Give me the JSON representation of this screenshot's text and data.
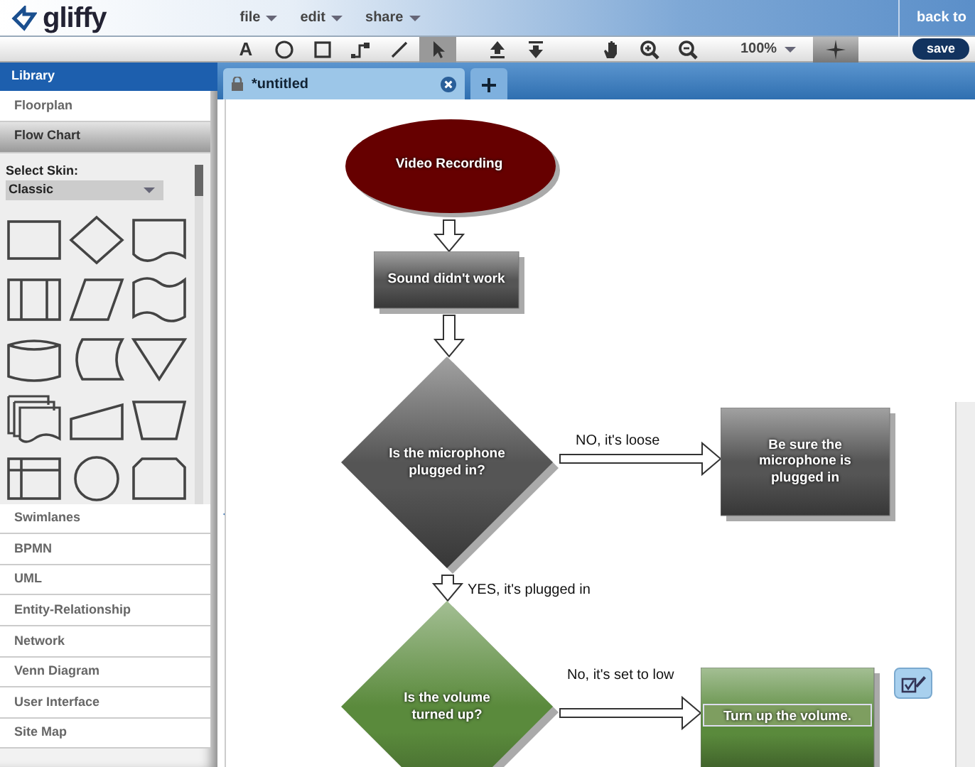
{
  "app": {
    "logo": "gliffy",
    "menus": [
      {
        "label": "file"
      },
      {
        "label": "edit"
      },
      {
        "label": "share"
      }
    ],
    "back_link": "back to"
  },
  "toolbar": {
    "tools": [
      {
        "kind": "text",
        "label": "A",
        "selected": false
      },
      {
        "kind": "ellipse",
        "selected": false
      },
      {
        "kind": "rectangle",
        "selected": false
      },
      {
        "kind": "connector",
        "selected": false
      },
      {
        "kind": "line",
        "selected": false
      },
      {
        "kind": "pointer",
        "selected": true
      }
    ],
    "actions": [
      {
        "kind": "bring-front"
      },
      {
        "kind": "send-back"
      },
      {
        "kind": "hand"
      },
      {
        "kind": "zoom-in"
      },
      {
        "kind": "zoom-out"
      }
    ],
    "zoom": "100%",
    "snap": {
      "on": true
    },
    "save": "save"
  },
  "tabs": [
    {
      "label": "*untitled",
      "selected": true
    }
  ],
  "sidebar": {
    "title": "Library",
    "categories": [
      {
        "label": "Floorplan",
        "expanded": false
      },
      {
        "label": "Flow Chart",
        "expanded": true,
        "skin_label": "Select Skin:",
        "skin_value": "Classic"
      },
      {
        "label": "Swimlanes",
        "expanded": false
      },
      {
        "label": "BPMN",
        "expanded": false
      },
      {
        "label": "UML",
        "expanded": false
      },
      {
        "label": "Entity-Relationship",
        "expanded": false
      },
      {
        "label": "Network",
        "expanded": false
      },
      {
        "label": "Venn Diagram",
        "expanded": false
      },
      {
        "label": "User Interface",
        "expanded": false
      },
      {
        "label": "Site Map",
        "expanded": false
      }
    ]
  },
  "diagram": {
    "nodes": [
      {
        "kind": "ellipse",
        "text": "Video Recording",
        "color": "#660000",
        "selected": false
      },
      {
        "kind": "rect",
        "text": "Sound didn't work",
        "color": "#555555",
        "selected": false
      },
      {
        "kind": "diamond",
        "text": "Is the microphone plugged in?",
        "color": "#555555",
        "selected": false
      },
      {
        "kind": "rect",
        "text": "Be sure the microphone is plugged in",
        "color": "#555555",
        "selected": false
      },
      {
        "kind": "diamond",
        "text": "Is the volume turned up?",
        "color": "#5a8a3c",
        "selected": false
      },
      {
        "kind": "rect",
        "text": "Turn up the volume.",
        "color": "#5a8a3c",
        "selected": true
      }
    ],
    "edges": [
      {
        "kind": "down"
      },
      {
        "kind": "down"
      },
      {
        "kind": "right",
        "label": "NO, it's loose"
      },
      {
        "kind": "down",
        "label": "YES, it's plugged in"
      },
      {
        "kind": "right",
        "label": "No, it's set to low"
      }
    ]
  }
}
